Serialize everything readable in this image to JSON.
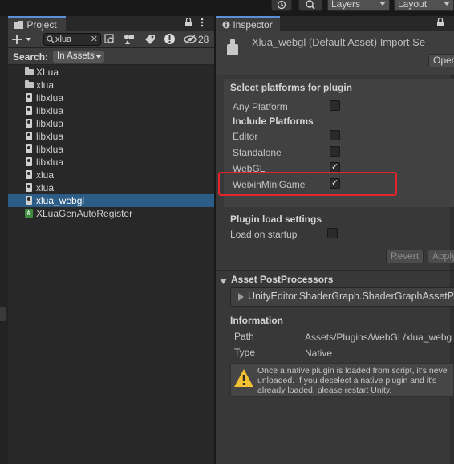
{
  "toolbar": {
    "layers_label": "Layers",
    "layout_label": "Layout"
  },
  "project": {
    "tab_label": "Project",
    "search_value": "xlua",
    "visible_count": "28",
    "search_label": "Search:",
    "scope_label": "In Assets",
    "items": [
      {
        "label": "XLua",
        "icon": "folder-icon"
      },
      {
        "label": "xlua",
        "icon": "folder-icon"
      },
      {
        "label": "libxlua",
        "icon": "plugin-file-icon"
      },
      {
        "label": "libxlua",
        "icon": "plugin-file-icon"
      },
      {
        "label": "libxlua",
        "icon": "plugin-file-icon"
      },
      {
        "label": "libxlua",
        "icon": "plugin-file-icon"
      },
      {
        "label": "libxlua",
        "icon": "plugin-file-icon"
      },
      {
        "label": "libxlua",
        "icon": "plugin-file-icon"
      },
      {
        "label": "xlua",
        "icon": "plugin-file-icon"
      },
      {
        "label": "xlua",
        "icon": "plugin-file-icon"
      },
      {
        "label": "xlua_webgl",
        "icon": "plugin-file-icon",
        "selected": true
      },
      {
        "label": "XLuaGenAutoRegister",
        "icon": "csharp-script-icon"
      }
    ]
  },
  "inspector": {
    "tab_label": "Inspector",
    "asset_title": "Xlua_webgl (Default Asset) Import Se",
    "open_label": "Oper",
    "platforms_heading": "Select platforms for plugin",
    "any_platform": {
      "label": "Any Platform",
      "checked": false
    },
    "include_heading": "Include Platforms",
    "platforms": [
      {
        "label": "Editor",
        "checked": false
      },
      {
        "label": "Standalone",
        "checked": false
      },
      {
        "label": "WebGL",
        "checked": true
      },
      {
        "label": "WeixinMiniGame",
        "checked": true
      }
    ],
    "load_heading": "Plugin load settings",
    "load_on_startup": {
      "label": "Load on startup",
      "checked": false
    },
    "revert_label": "Revert",
    "apply_label": "Apply",
    "postprocessors_heading": "Asset PostProcessors",
    "postprocessor_item": "UnityEditor.ShaderGraph.ShaderGraphAssetPo",
    "info_heading": "Information",
    "path_label": "Path",
    "path_value": "Assets/Plugins/WebGL/xlua_webg",
    "type_label": "Type",
    "type_value": "Native",
    "warning_lines": [
      "Once a native plugin is loaded from script, it's neve",
      "unloaded. If you deselect a native plugin and it's",
      "already loaded, please restart Unity."
    ]
  },
  "colors": {
    "selection": "#2c5d87",
    "highlight_box": "#e0262a",
    "tab_accent": "#5b8fd9"
  }
}
